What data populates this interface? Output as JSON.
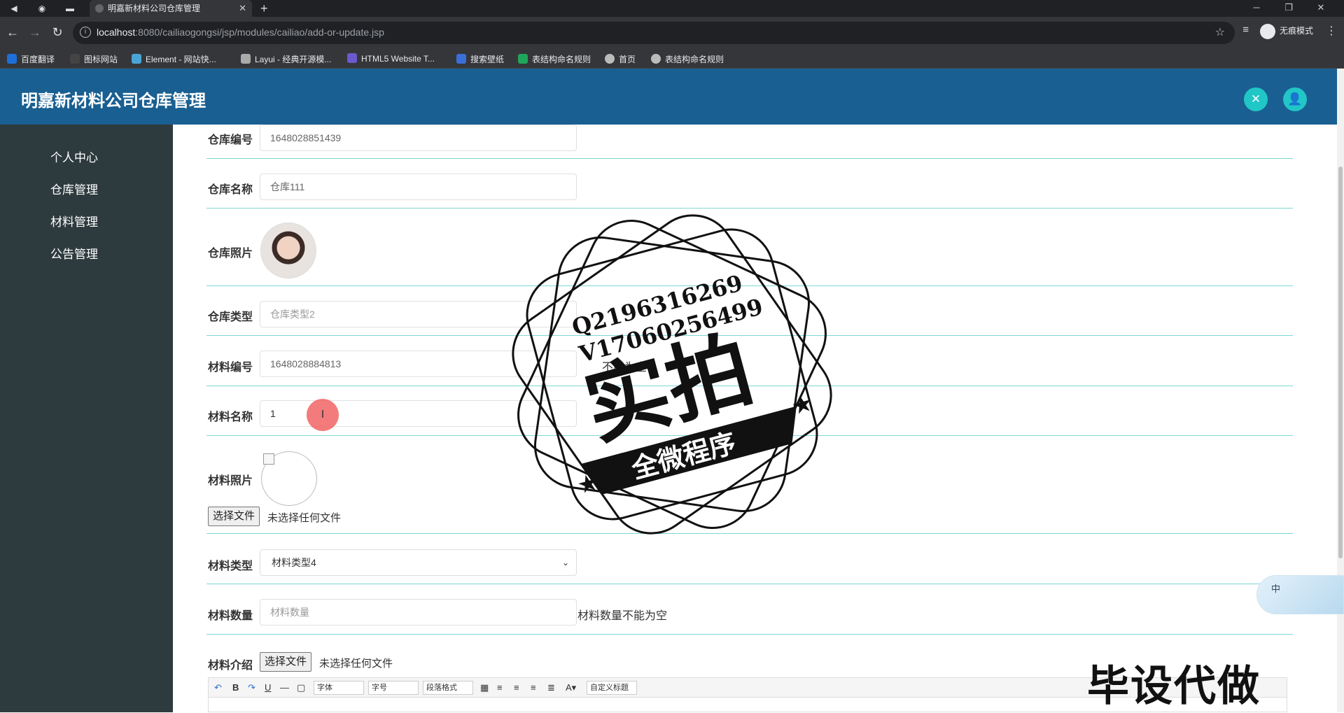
{
  "browser": {
    "tab_title": "明嘉新材料公司仓库管理",
    "url_host": "localhost",
    "url_rest": ":8080/cailiaogongsi/jsp/modules/cailiao/add-or-update.jsp",
    "incognito_label": "无痕模式",
    "bookmarks": [
      "百度翻译",
      "图标网站",
      "Element - 网站快...",
      "Layui - 经典开源模...",
      "HTML5 Website T...",
      "搜索壁纸",
      "表结构命名规则",
      "首页",
      "表结构命名规则"
    ],
    "bookmark_colors": [
      "#1e6fd9",
      "#444",
      "#4aa4d8",
      "#aaa",
      "#6a5acd",
      "#3a6fd8",
      "#1fa65a",
      "#bbb",
      "#bbb"
    ]
  },
  "app": {
    "title": "明嘉新材料公司仓库管理",
    "header_bg": "#1a5f91",
    "accent": "#21c6c6"
  },
  "sidebar": {
    "items": [
      "个人中心",
      "仓库管理",
      "材料管理",
      "公告管理"
    ]
  },
  "form": {
    "fields": {
      "cangku_bianhao": {
        "label": "仓库编号",
        "value": "1648028851439"
      },
      "cangku_mingcheng": {
        "label": "仓库名称",
        "value": "仓库111"
      },
      "cangku_zhaopian": {
        "label": "仓库照片"
      },
      "cangku_leixing": {
        "label": "仓库类型",
        "value": "仓库类型2"
      },
      "cailiao_bianhao": {
        "label": "材料编号",
        "value": "1648028884813",
        "hint": "不能为空"
      },
      "cailiao_mingcheng": {
        "label": "材料名称",
        "value": "1"
      },
      "cailiao_zhaopian": {
        "label": "材料照片",
        "file_button": "选择文件",
        "file_status": "未选择任何文件"
      },
      "cailiao_leixing": {
        "label": "材料类型",
        "selected": "材料类型4"
      },
      "cailiao_shuliang": {
        "label": "材料数量",
        "placeholder": "材料数量",
        "hint": "材料数量不能为空"
      },
      "cailiao_jieshao": {
        "label": "材料介绍",
        "file_button": "选择文件",
        "file_status": "未选择任何文件"
      }
    },
    "editor_toolbar": {
      "font_family": "字体",
      "font_size": "字号",
      "paragraph": "段落格式",
      "custom_heading": "自定义标题"
    }
  },
  "overlay": {
    "stamp_line1": "Q2196316269",
    "stamp_line2": "V17060256499",
    "stamp_main": "实拍",
    "stamp_ribbon": "全微程序",
    "watermark": "毕设代做",
    "ime": "中"
  }
}
